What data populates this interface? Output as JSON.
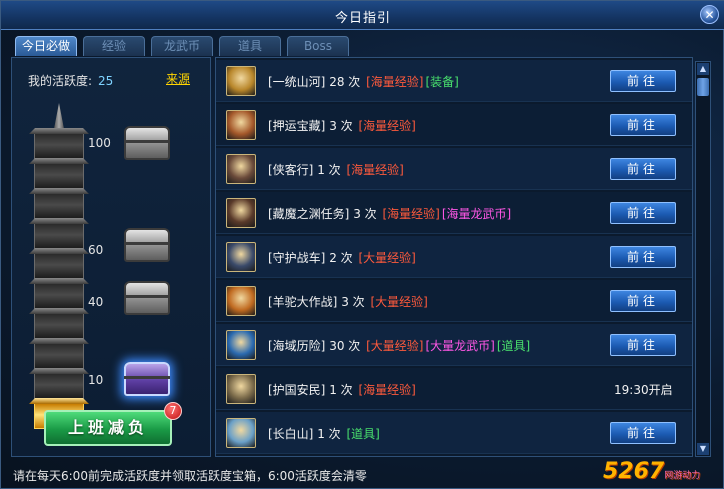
{
  "window": {
    "title": "今日指引",
    "close_glyph": "✕"
  },
  "tabs": [
    {
      "label": "今日必做",
      "active": true
    },
    {
      "label": "经验",
      "active": false
    },
    {
      "label": "龙武币",
      "active": false
    },
    {
      "label": "道具",
      "active": false
    },
    {
      "label": "Boss",
      "active": false
    }
  ],
  "left": {
    "activity_label": "我的活跃度:",
    "activity_value": "25",
    "source_link": "来源",
    "milestones": [
      {
        "value": "100",
        "chest": "silver"
      },
      {
        "value": "60",
        "chest": "silver"
      },
      {
        "value": "40",
        "chest": "silver"
      },
      {
        "value": "10",
        "chest": "purple"
      }
    ],
    "pagoda_tiers_total": 10,
    "pagoda_tiers_lit": 1,
    "big_button": "上班减负",
    "badge_count": "7"
  },
  "tasks": [
    {
      "name": "[一统山河]",
      "count": "28 次",
      "rewards": [
        {
          "text": "[海量经验]",
          "color": "red"
        },
        {
          "text": "[装备]",
          "color": "green"
        }
      ],
      "action": "前往",
      "icon": "warrior-portrait-icon",
      "icon_color": "#b8862a"
    },
    {
      "name": "[押运宝藏]",
      "count": "3 次",
      "rewards": [
        {
          "text": "[海量经验]",
          "color": "red"
        }
      ],
      "action": "前往",
      "icon": "escort-portrait-icon",
      "icon_color": "#a4582a"
    },
    {
      "name": "[侠客行]",
      "count": "1 次",
      "rewards": [
        {
          "text": "[海量经验]",
          "color": "red"
        }
      ],
      "action": "前往",
      "icon": "hero-portrait-icon",
      "icon_color": "#6a4a3a"
    },
    {
      "name": "[藏魔之渊任务]",
      "count": "3 次",
      "rewards": [
        {
          "text": "[海量经验]",
          "color": "red"
        },
        {
          "text": "[海量龙武币]",
          "color": "magenta"
        }
      ],
      "action": "前往",
      "icon": "demon-portrait-icon",
      "icon_color": "#5a3a2a"
    },
    {
      "name": "[守护战车]",
      "count": "2 次",
      "rewards": [
        {
          "text": "[大量经验]",
          "color": "red"
        }
      ],
      "action": "前往",
      "icon": "chariot-icon",
      "icon_color": "#3a4a6a"
    },
    {
      "name": "[羊驼大作战]",
      "count": "3 次",
      "rewards": [
        {
          "text": "[大量经验]",
          "color": "red"
        }
      ],
      "action": "前往",
      "icon": "alpaca-icon",
      "icon_color": "#c06a20"
    },
    {
      "name": "[海域历险]",
      "count": "30 次",
      "rewards": [
        {
          "text": "[大量经验]",
          "color": "red"
        },
        {
          "text": "[大量龙武币]",
          "color": "magenta"
        },
        {
          "text": "[道具]",
          "color": "green"
        }
      ],
      "action": "前往",
      "icon": "ship-icon",
      "icon_color": "#2a6ab0"
    },
    {
      "name": "[护国安民]",
      "count": "1 次",
      "rewards": [
        {
          "text": "[海量经验]",
          "color": "red"
        }
      ],
      "action": "",
      "open_time": "19:30开启",
      "icon": "guard-portrait-icon",
      "icon_color": "#7a6a4a"
    },
    {
      "name": "[长白山]",
      "count": "1 次",
      "rewards": [
        {
          "text": "[道具]",
          "color": "green"
        }
      ],
      "action": "前往",
      "icon": "mountain-sword-icon",
      "icon_color": "#6aa0c8"
    }
  ],
  "scrollbar": {
    "up": "▲",
    "down": "▼"
  },
  "footer": "请在每天6:00前完成活跃度并领取活跃度宝箱，6:00活跃度会清零",
  "watermark": {
    "text": "5267",
    "sub": "网游动力"
  },
  "colors": {
    "accent_blue": "#1c5bb3",
    "reward_red": "#ff5a3c",
    "reward_green": "#49e06d",
    "reward_magenta": "#ff57e6",
    "gold": "#ffd400"
  }
}
